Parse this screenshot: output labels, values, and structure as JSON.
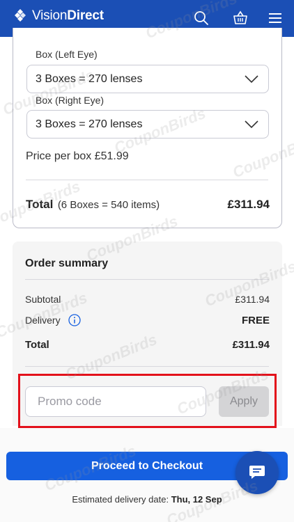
{
  "header": {
    "logo_regular": "Vision",
    "logo_bold": "Direct",
    "icons": [
      "search-icon",
      "basket-icon",
      "menu-icon"
    ],
    "bg_color": "#1b4fb5"
  },
  "product": {
    "left_label": "Box (Left Eye)",
    "left_value": "3 Boxes = 270 lenses",
    "right_label": "Box (Right Eye)",
    "right_value": "3 Boxes = 270 lenses",
    "price_per_box": "Price per box £51.99",
    "total_label": "Total",
    "total_detail": "(6 Boxes = 540 items)",
    "total_price": "£311.94"
  },
  "summary": {
    "title": "Order summary",
    "subtotal_label": "Subtotal",
    "subtotal_value": "£311.94",
    "delivery_label": "Delivery",
    "delivery_value": "FREE",
    "total_label": "Total",
    "total_value": "£311.94"
  },
  "promo": {
    "placeholder": "Promo code",
    "apply_label": "Apply",
    "highlight_color": "#e3111b"
  },
  "checkout": {
    "button_label": "Proceed to Checkout",
    "est_prefix": "Estimated delivery date:",
    "est_date": "Thu, 12 Sep",
    "button_color": "#1660e0"
  },
  "watermark": {
    "text": "CouponBirds"
  }
}
